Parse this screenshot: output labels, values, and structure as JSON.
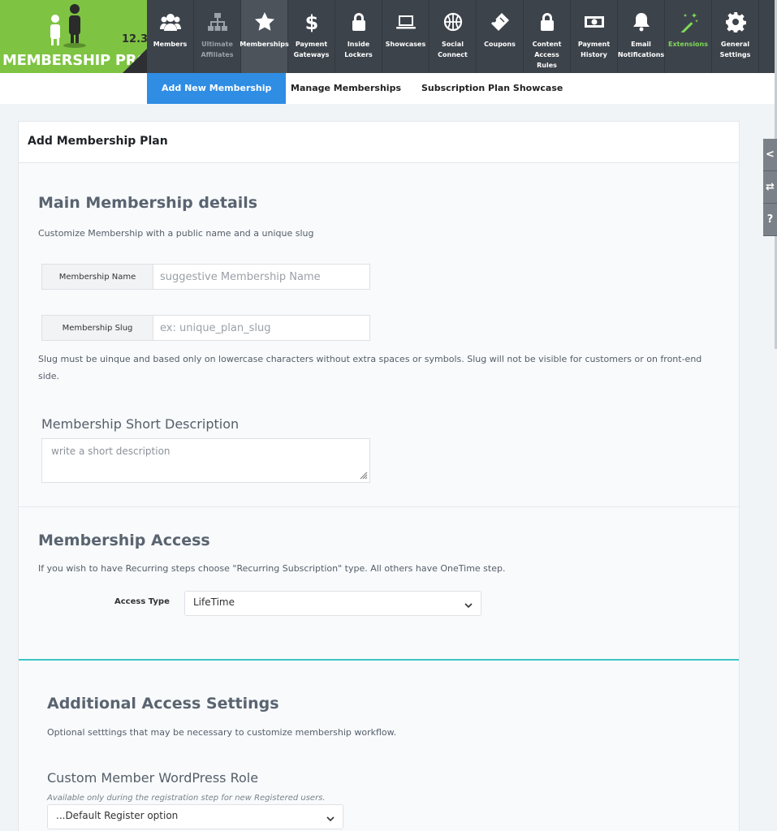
{
  "logo": {
    "brand": "MEMBERSHIP PRO",
    "version": "12.3"
  },
  "nav": [
    {
      "label": "Members",
      "icon": "members-icon",
      "state": "normal"
    },
    {
      "label": "Ultimate\nAffiliates",
      "icon": "sitemap-icon",
      "state": "dim"
    },
    {
      "label": "Memberships",
      "icon": "star-icon",
      "state": "active"
    },
    {
      "label": "Payment\nGateways",
      "icon": "dollar-icon",
      "state": "normal"
    },
    {
      "label": "Inside\nLockers",
      "icon": "lock-icon",
      "state": "normal"
    },
    {
      "label": "Showcases",
      "icon": "laptop-icon",
      "state": "normal"
    },
    {
      "label": "Social\nConnect",
      "icon": "basketball-icon",
      "state": "normal"
    },
    {
      "label": "Coupons",
      "icon": "ticket-icon",
      "state": "normal"
    },
    {
      "label": "Content\nAccess\nRules",
      "icon": "lock-icon",
      "state": "normal"
    },
    {
      "label": "Payment\nHistory",
      "icon": "money-bill-icon",
      "state": "normal"
    },
    {
      "label": "Email\nNotifications",
      "icon": "bell-icon",
      "state": "normal"
    },
    {
      "label": "Extensions",
      "icon": "magic-wand-icon",
      "state": "green"
    },
    {
      "label": "General\nSettings",
      "icon": "gear-icon",
      "state": "normal"
    }
  ],
  "tabs": {
    "add_new": "Add New Membership",
    "manage": "Manage Memberships",
    "showcase": "Subscription Plan Showcase"
  },
  "card": {
    "title": "Add Membership Plan"
  },
  "main_details": {
    "heading": "Main Membership details",
    "desc": "Customize Membership with a public name and a unique slug",
    "name_label": "Membership Name",
    "name_placeholder": "suggestive Membership Name",
    "slug_label": "Membership Slug",
    "slug_placeholder": "ex: unique_plan_slug",
    "slug_note": "Slug must be uinque and based only on lowercase characters without extra spaces or symbols. Slug will not be visible for customers or on front-end side.",
    "short_desc_heading": "Membership Short Description",
    "short_desc_placeholder": "write a short description"
  },
  "access": {
    "heading": "Membership Access",
    "desc": "If you wish to have Recurring steps choose \"Recurring Subscription\" type. All others have OneTime step.",
    "type_label": "Access Type",
    "type_value": "LifeTime"
  },
  "additional": {
    "heading": "Additional Access Settings",
    "desc": "Optional setttings that may be necessary to customize membership workflow.",
    "role_heading": "Custom Member WordPress Role",
    "role_note": "Available only during the registration step for new Registered users.",
    "role_value": "...Default Register option"
  },
  "sidetabs": [
    "<",
    "⇄",
    "?"
  ],
  "colors": {
    "topbar": "#3d434b",
    "logo_green": "#7ec442",
    "active_tab": "#2f8de4",
    "extensions_green": "#7ed957",
    "section_divider": "#3cc5c7"
  }
}
